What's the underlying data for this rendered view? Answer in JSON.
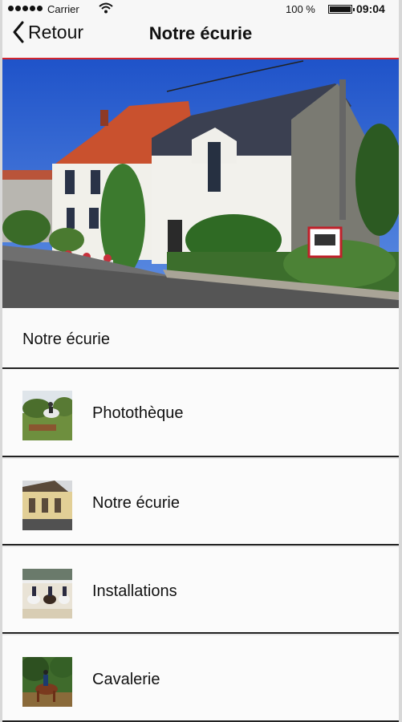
{
  "statusbar": {
    "carrier": "Carrier",
    "battery": "100 %",
    "time": "09:04"
  },
  "navbar": {
    "back_label": "Retour",
    "title": "Notre écurie",
    "accent": "#d2242e"
  },
  "section": {
    "title": "Notre écurie"
  },
  "items": [
    {
      "label": "Photothèque",
      "icon": "photo-riding-thumb"
    },
    {
      "label": "Notre écurie",
      "icon": "stable-building-thumb"
    },
    {
      "label": "Installations",
      "icon": "arena-riders-thumb"
    },
    {
      "label": "Cavalerie",
      "icon": "horse-rider-thumb"
    }
  ]
}
